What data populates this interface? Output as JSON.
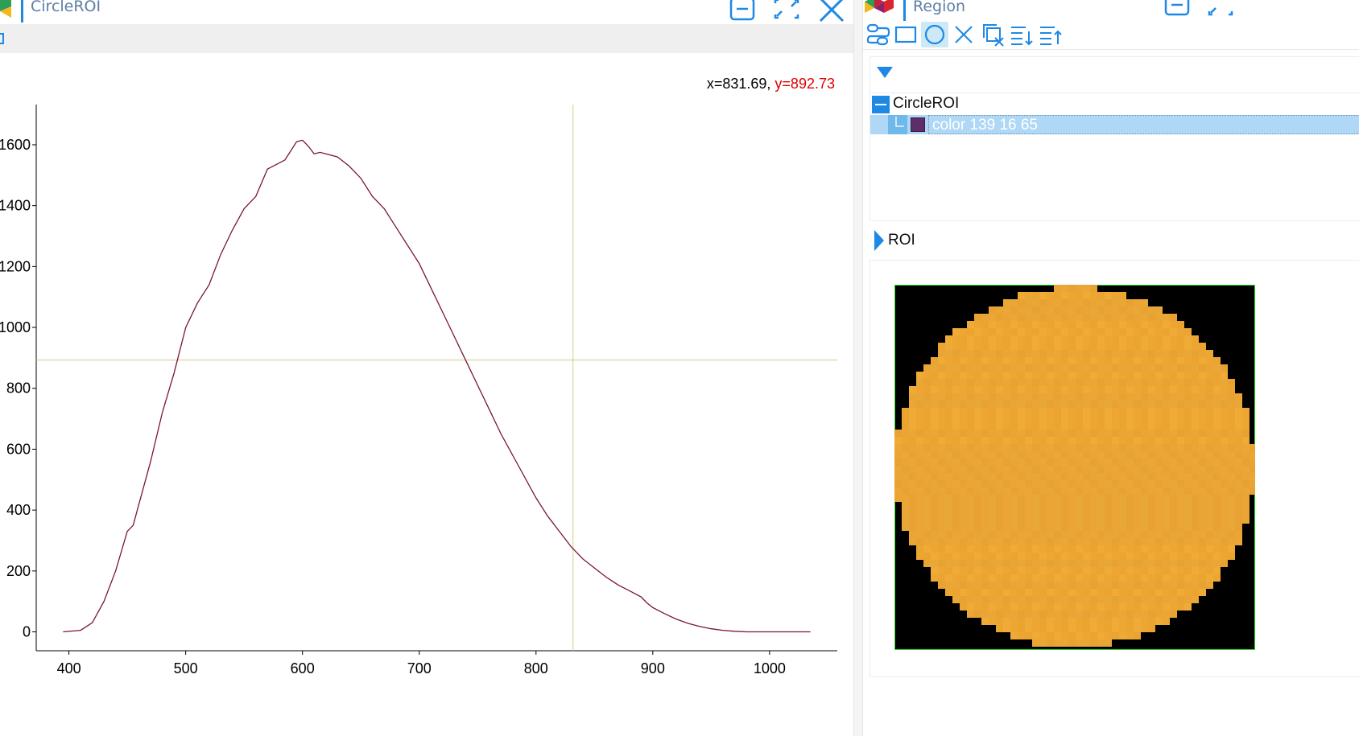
{
  "left_window": {
    "title": "CircleROI",
    "coord_readout": {
      "x_text": "x=831.69,",
      "y_text": "y=892.73"
    }
  },
  "right_window": {
    "title": "Region",
    "toolbar": [
      "link-tool-icon",
      "rectangle-tool-icon",
      "circle-tool-icon",
      "delete-icon",
      "clear-all-icon",
      "sort-descending-icon",
      "sort-ascending-icon"
    ],
    "tree": {
      "root_label": "CircleROI",
      "child_label": "color 139 16 65",
      "child_color": "#5c2f6a"
    },
    "roi_section_label": "ROI"
  },
  "colors": {
    "accent": "#1e88e5",
    "curve": "#7a1630",
    "crosshair": "#c8cf8a",
    "roi_fill": "#eea633",
    "roi_border": "#22dd22"
  },
  "chart_data": {
    "type": "line",
    "title": "",
    "xlabel": "",
    "ylabel": "",
    "xlim": [
      372,
      1058
    ],
    "ylim": [
      -62,
      1732
    ],
    "x_ticks": [
      400,
      500,
      600,
      700,
      800,
      900,
      1000
    ],
    "y_ticks": [
      0,
      200,
      400,
      600,
      800,
      1000,
      1200,
      1400,
      1600
    ],
    "crosshair": {
      "x": 831.69,
      "y": 892.73
    },
    "series": [
      {
        "x": [
          395,
          410,
          420,
          430,
          440,
          450,
          455,
          460,
          470,
          480,
          490,
          500,
          510,
          520,
          530,
          540,
          550,
          560,
          570,
          580,
          585,
          590,
          595,
          600,
          605,
          610,
          615,
          620,
          630,
          640,
          650,
          660,
          670,
          680,
          690,
          700,
          710,
          720,
          730,
          740,
          750,
          760,
          770,
          780,
          790,
          800,
          810,
          820,
          830,
          840,
          850,
          860,
          870,
          880,
          890,
          895,
          900,
          910,
          920,
          930,
          940,
          950,
          960,
          970,
          980,
          990,
          1000,
          1010,
          1020,
          1030,
          1035
        ],
        "y": [
          0,
          5,
          30,
          100,
          200,
          330,
          350,
          420,
          560,
          720,
          850,
          1000,
          1080,
          1140,
          1240,
          1320,
          1390,
          1430,
          1520,
          1540,
          1550,
          1580,
          1610,
          1615,
          1595,
          1570,
          1575,
          1570,
          1560,
          1530,
          1490,
          1430,
          1390,
          1330,
          1270,
          1210,
          1130,
          1050,
          970,
          890,
          810,
          730,
          650,
          580,
          510,
          440,
          380,
          330,
          280,
          240,
          210,
          180,
          155,
          135,
          115,
          95,
          80,
          60,
          42,
          28,
          18,
          10,
          5,
          2,
          0,
          0,
          0,
          0,
          0,
          0,
          0
        ]
      }
    ]
  }
}
